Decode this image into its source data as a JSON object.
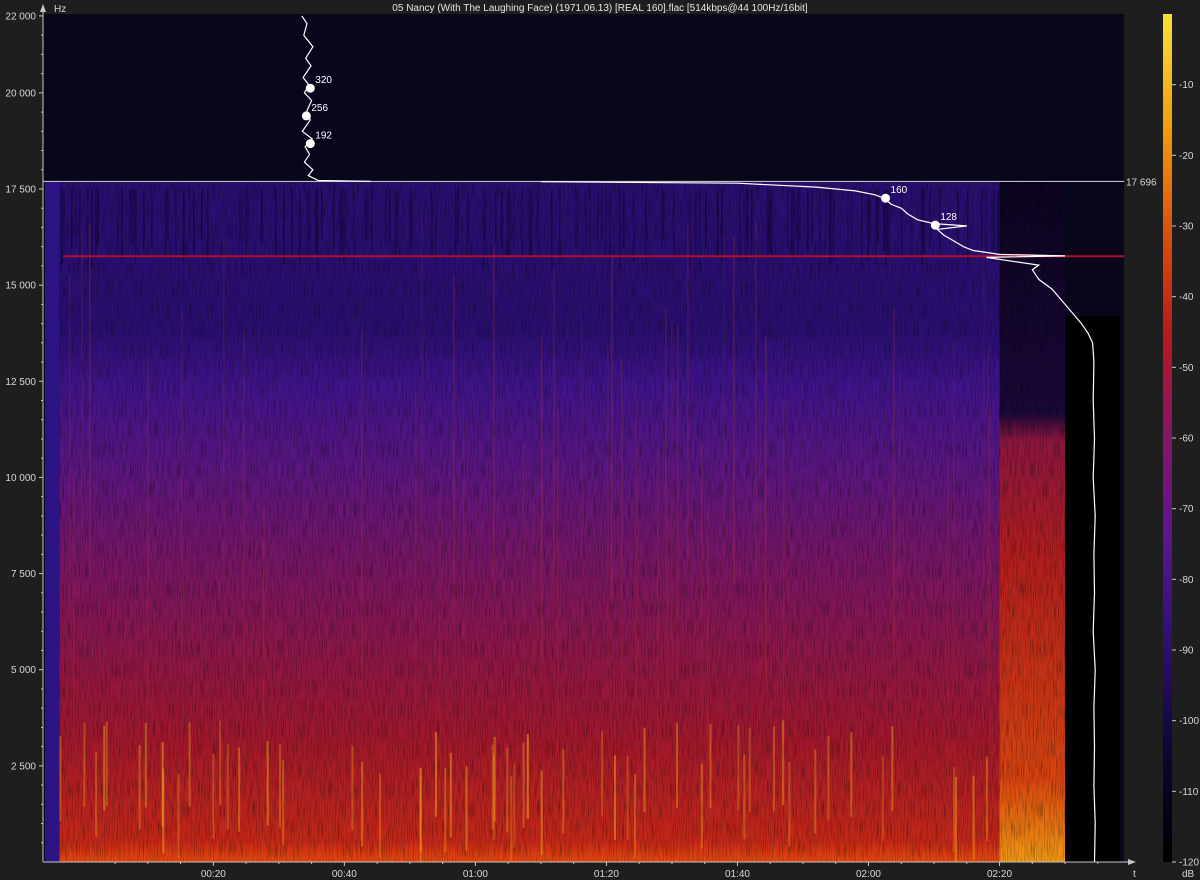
{
  "window": {
    "title": "05 Nancy (With The Laughing Face) (1971.06.13) [REAL 160].flac [514kbps@44 100Hz/16bit]"
  },
  "colors": {
    "background": "#1e1e1e",
    "axis": "#c8c8c8",
    "text": "#d8d8d8",
    "cutoff_line": "#bdbdbd",
    "red_line": "#b0102c",
    "curve": "#ffffff",
    "colormap": [
      "#000000",
      "#0e0430",
      "#2b0f6b",
      "#4a1590",
      "#7a1670",
      "#a8182a",
      "#d4400c",
      "#f08a10",
      "#f7d21a",
      "#fff36a"
    ]
  },
  "chart_data": {
    "type": "heatmap",
    "title": "05 Nancy (With The Laughing Face) (1971.06.13) [REAL 160].flac [514kbps@44 100Hz/16bit]",
    "xlabel": "t",
    "ylabel": "Hz",
    "x_tick_labels": [
      "00:20",
      "00:40",
      "01:00",
      "01:20",
      "01:40",
      "02:00",
      "02:20"
    ],
    "x_tick_seconds": [
      20,
      40,
      60,
      80,
      100,
      120,
      140
    ],
    "xlim_seconds": [
      -6,
      159
    ],
    "y_tick_labels": [
      "22 000",
      "20 000",
      "17 500",
      "15 000",
      "12 500",
      "10 000",
      "7 500",
      "5 000",
      "2 500"
    ],
    "y_tick_values": [
      22000,
      20000,
      17500,
      15000,
      12500,
      10000,
      7500,
      5000,
      2500
    ],
    "ylim_hz": [
      0,
      22050
    ],
    "audio_span_seconds": [
      -3.5,
      150
    ],
    "quiet_tail_seconds": [
      140,
      150
    ],
    "cutoff_hz": 17696,
    "cutoff_label": "17 696",
    "red_line_hz": 15750,
    "colorbar": {
      "label": "dB",
      "tick_labels": [
        "-10",
        "-20",
        "-30",
        "-40",
        "-50",
        "-60",
        "-70",
        "-80",
        "-90",
        "-100",
        "-110",
        "-120"
      ],
      "tick_values": [
        -10,
        -20,
        -30,
        -40,
        -50,
        -60,
        -70,
        -80,
        -90,
        -100,
        -110,
        -120
      ],
      "range_db": [
        -120,
        0
      ]
    },
    "bitrate_markers": [
      {
        "label": "320",
        "t": 34.8,
        "hz": 20120
      },
      {
        "label": "256",
        "t": 34.2,
        "hz": 19400
      },
      {
        "label": "192",
        "t": 34.8,
        "hz": 18680
      },
      {
        "label": "160",
        "t": 122.6,
        "hz": 17260
      },
      {
        "label": "128",
        "t": 130.2,
        "hz": 16560
      }
    ],
    "profile_curve_upper": [
      [
        22000,
        33.5
      ],
      [
        21800,
        34.3
      ],
      [
        21500,
        33.8
      ],
      [
        21200,
        35.2
      ],
      [
        20900,
        34.1
      ],
      [
        20700,
        34.9
      ],
      [
        20400,
        33.7
      ],
      [
        20200,
        34.6
      ],
      [
        20000,
        33.9
      ],
      [
        19800,
        35.0
      ],
      [
        19500,
        34.2
      ],
      [
        19300,
        34.8
      ],
      [
        19000,
        33.6
      ],
      [
        18800,
        35.1
      ],
      [
        18600,
        34.0
      ],
      [
        18400,
        34.7
      ],
      [
        18200,
        33.9
      ],
      [
        18000,
        35.2
      ],
      [
        17850,
        34.5
      ],
      [
        17720,
        36.0
      ],
      [
        17700,
        44.0
      ]
    ],
    "profile_curve_lower": [
      [
        17690,
        70.0
      ],
      [
        17650,
        100.0
      ],
      [
        17550,
        112.0
      ],
      [
        17450,
        118.0
      ],
      [
        17350,
        121.0
      ],
      [
        17250,
        122.5
      ],
      [
        17100,
        123.5
      ],
      [
        17000,
        125.0
      ],
      [
        16850,
        126.0
      ],
      [
        16700,
        127.5
      ],
      [
        16600,
        130.0
      ],
      [
        16540,
        135.0
      ],
      [
        16450,
        130.5
      ],
      [
        16300,
        131.5
      ],
      [
        16150,
        133.0
      ],
      [
        16000,
        134.5
      ],
      [
        15900,
        136.0
      ],
      [
        15800,
        140.0
      ],
      [
        15760,
        150.0
      ],
      [
        15720,
        138.0
      ],
      [
        15620,
        142.0
      ],
      [
        15520,
        146.0
      ],
      [
        15400,
        145.0
      ],
      [
        15150,
        146.0
      ],
      [
        14900,
        148.0
      ],
      [
        14600,
        149.5
      ],
      [
        14300,
        151.0
      ],
      [
        14000,
        152.5
      ],
      [
        13750,
        153.5
      ],
      [
        13500,
        154.2
      ],
      [
        13000,
        154.4
      ],
      [
        12000,
        154.3
      ],
      [
        11000,
        154.5
      ],
      [
        10000,
        154.3
      ],
      [
        9000,
        154.6
      ],
      [
        8000,
        154.4
      ],
      [
        7000,
        154.5
      ],
      [
        6000,
        154.3
      ],
      [
        5000,
        154.6
      ],
      [
        4000,
        154.4
      ],
      [
        3000,
        154.5
      ],
      [
        2000,
        154.4
      ],
      [
        1000,
        154.6
      ],
      [
        0,
        154.5
      ]
    ]
  }
}
